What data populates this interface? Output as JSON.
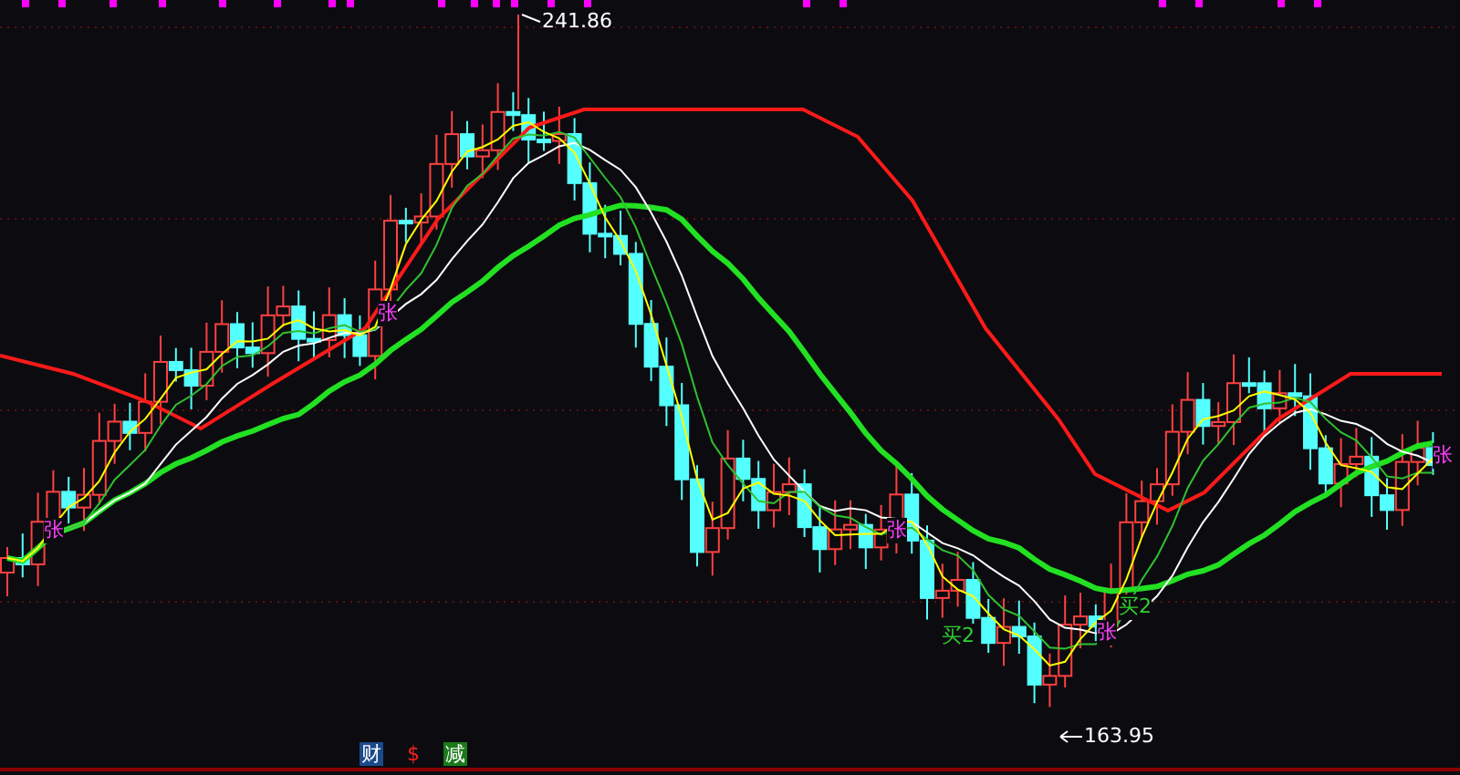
{
  "chart": {
    "high_label": "241.86",
    "low_label": "163.95",
    "signals": [
      {
        "text": "张",
        "kind": "rise"
      },
      {
        "text": "张",
        "kind": "rise"
      },
      {
        "text": "张",
        "kind": "rise"
      },
      {
        "text": "张",
        "kind": "rise"
      },
      {
        "text": "张",
        "kind": "rise"
      },
      {
        "text": "买2",
        "kind": "buy"
      },
      {
        "text": "买2",
        "kind": "buy"
      }
    ]
  },
  "bottom_tags": [
    {
      "text": "财",
      "kind": "finance"
    },
    {
      "text": "$",
      "kind": "money"
    },
    {
      "text": "减",
      "kind": "reduce"
    }
  ]
}
